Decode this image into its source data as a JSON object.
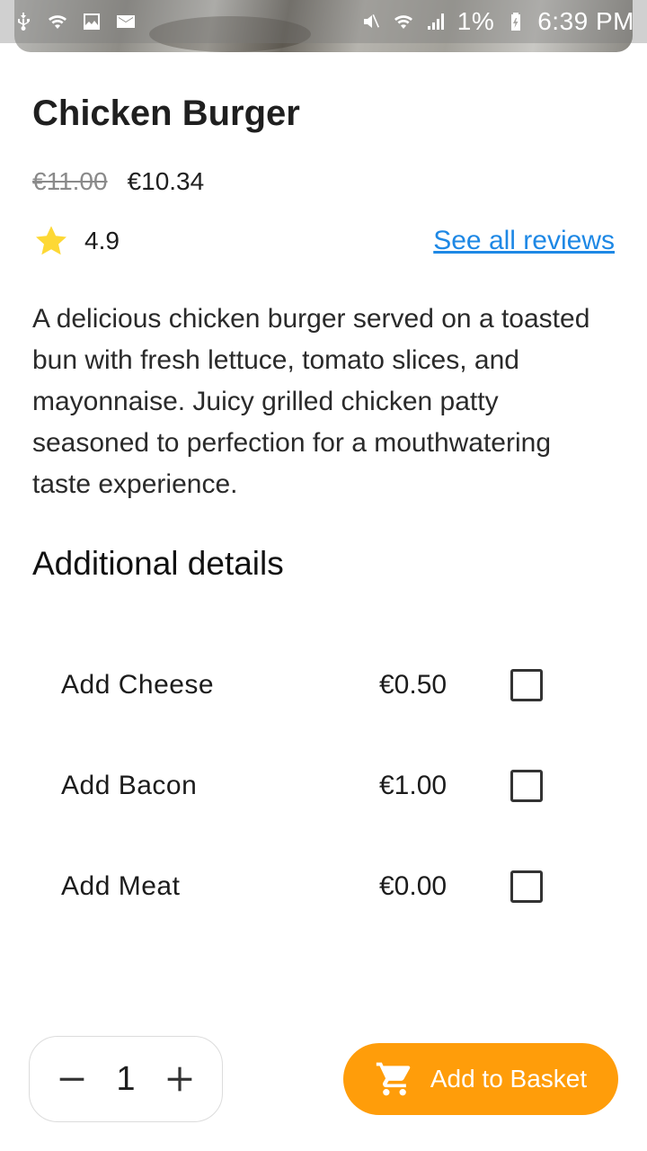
{
  "status_bar": {
    "battery": "1%",
    "time": "6:39 PM",
    "icons_left": [
      "usb-icon",
      "wifi-icon",
      "image-icon",
      "mail-icon"
    ],
    "icons_right": [
      "mute-icon",
      "wifi-icon",
      "signal-icon",
      "battery-icon"
    ]
  },
  "product": {
    "title": "Chicken Burger",
    "old_price": "€11.00",
    "price": "€10.34",
    "rating": "4.9",
    "reviews_link": "See all reviews",
    "description": "A delicious chicken burger served on a toasted bun with fresh lettuce, tomato slices, and mayonnaise. Juicy grilled chicken patty seasoned to perfection for a mouthwatering taste experience."
  },
  "details": {
    "title": "Additional details",
    "options": [
      {
        "label": "Add Cheese",
        "price": "€0.50",
        "checked": false
      },
      {
        "label": "Add Bacon",
        "price": "€1.00",
        "checked": false
      },
      {
        "label": "Add Meat",
        "price": "€0.00",
        "checked": false
      }
    ]
  },
  "footer": {
    "quantity": "1",
    "add_button": "Add to Basket"
  },
  "colors": {
    "accent": "#ff9d0a",
    "link": "#1e88e5",
    "star": "#fdd835"
  }
}
